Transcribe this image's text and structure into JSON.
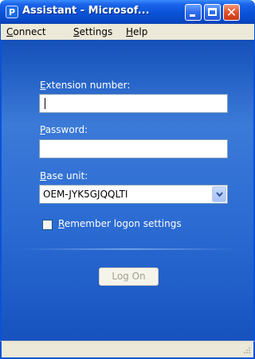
{
  "window": {
    "title": "Assistant - Microsof...",
    "icon_glyph": "ᴘ",
    "icon_name": "phone-assistant-icon",
    "close_glyph": "✕"
  },
  "menu": {
    "items": [
      "Connect",
      "Settings",
      "Help"
    ]
  },
  "form": {
    "extension_label": "Extension number:",
    "extension_value": "",
    "password_label": "Password:",
    "password_value": "",
    "base_unit_label": "Base unit:",
    "base_unit_value": "OEM-JYK5GJQQLTI",
    "remember_label": "Remember logon settings",
    "remember_checked": false,
    "logon_button": "Log On"
  },
  "colors": {
    "titlebar_blue": "#0a52d8",
    "client_blue": "#2b6bd2",
    "close_red": "#e0502a"
  }
}
